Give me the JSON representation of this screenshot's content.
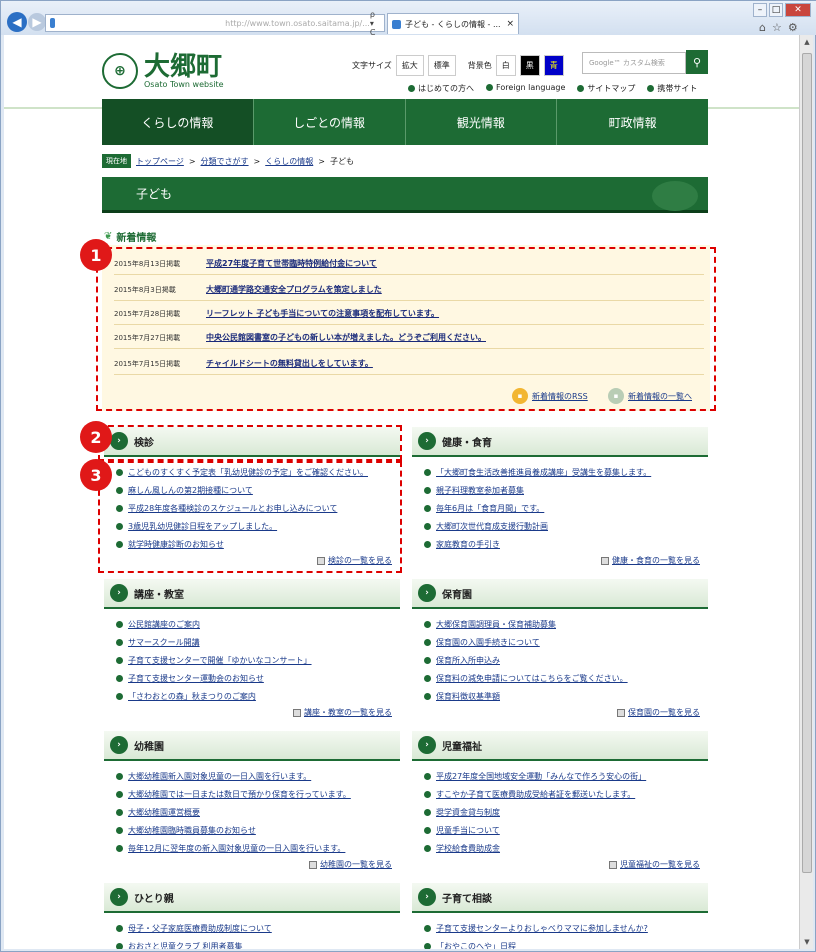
{
  "browser": {
    "address_url": "http://www.town.osato.saitama.jp/...",
    "search_hint": "ρ ▾ C",
    "tab_title": "子ども - くらしの情報 - ...",
    "tab_close": "×"
  },
  "site": {
    "name": "大郷町",
    "subtitle": "Osato Town website",
    "emblem": "⊕"
  },
  "util": {
    "fontsize_label": "文字サイズ",
    "enlarge": "拡大",
    "standard": "標準",
    "bgcolor_label": "背景色",
    "white": "白",
    "black": "黒",
    "blue": "青",
    "search_placeholder": "Google™ カスタム検索"
  },
  "header_links": [
    "はじめての方へ",
    "Foreign language",
    "サイトマップ",
    "携帯サイト"
  ],
  "global_nav": [
    "くらしの情報",
    "しごとの情報",
    "観光情報",
    "町政情報"
  ],
  "breadcrumb": {
    "here": "現在地",
    "items": [
      "トップページ",
      "分類でさがす",
      "くらしの情報"
    ],
    "current": "子ども",
    "sep": ">"
  },
  "page_title": "子ども",
  "news": {
    "heading": "新着情報",
    "items": [
      {
        "date": "2015年8月13日掲載",
        "title": "平成27年度子育て世帯臨時特例給付金について"
      },
      {
        "date": "2015年8月3日掲載",
        "title": "大郷町通学路交通安全プログラムを策定しました"
      },
      {
        "date": "2015年7月28日掲載",
        "title": "リーフレット 子ども手当についての注意事項を配布しています。"
      },
      {
        "date": "2015年7月27日掲載",
        "title": "中央公民館図書室の子どもの新しい本が増えました。どうぞご利用ください。"
      },
      {
        "date": "2015年7月15日掲載",
        "title": "チャイルドシートの無料貸出しをしています。"
      }
    ],
    "rss": "新着情報のRSS",
    "list": "新着情報の一覧へ"
  },
  "sections": [
    {
      "title": "検診",
      "items": [
        "こどものすくすく予定表「乳幼児健診の予定」をご確認ください。",
        "麻しん風しんの第2期接種について",
        "平成28年度各種検診のスケジュールとお申し込みについて",
        "3歳児乳幼児健診日程をアップしました。",
        "就学時健康診断のお知らせ"
      ],
      "more": "検診の一覧を見る"
    },
    {
      "title": "健康・食育",
      "items": [
        "「大郷町食生活改善推進員養成講座」受講生を募集します。",
        "親子料理教室参加者募集",
        "毎年6月は「食育月間」です。",
        "大郷町次世代育成支援行動計画",
        "家庭教育の手引き"
      ],
      "more": "健康・食育の一覧を見る"
    },
    {
      "title": "講座・教室",
      "items": [
        "公民館講座のご案内",
        "サマースクール開講",
        "子育て支援センターで開催「ゆかいなコンサート」",
        "子育て支援センター運動会のお知らせ",
        "「さわおとの森」秋まつりのご案内"
      ],
      "more": "講座・教室の一覧を見る"
    },
    {
      "title": "保育園",
      "items": [
        "大郷保育園調理員・保育補助募集",
        "保育園の入園手続きについて",
        "保育所入所申込み",
        "保育料の減免申請についてはこちらをご覧ください。",
        "保育料徴収基準額"
      ],
      "more": "保育園の一覧を見る"
    },
    {
      "title": "幼稚園",
      "items": [
        "大郷幼稚園新入園対象児童の一日入園を行います。",
        "大郷幼稚園では一日または数日で預かり保育を行っています。",
        "大郷幼稚園運営概要",
        "大郷幼稚園臨時職員募集のお知らせ",
        "毎年12月に翌年度の新入園対象児童の一日入園を行います。"
      ],
      "more": "幼稚園の一覧を見る"
    },
    {
      "title": "児童福祉",
      "items": [
        "平成27年度全国地域安全運動「みんなで作ろう安心の街」",
        "すこやか子育て医療費助成受給者証を郵送いたします。",
        "奨学資金貸与制度",
        "児童手当について",
        "学校給食費助成金"
      ],
      "more": "児童福祉の一覧を見る"
    },
    {
      "title": "ひとり親",
      "items": [
        "母子・父子家庭医療費助成制度について",
        "おおさと児童クラブ 利用者募集"
      ],
      "more": ""
    },
    {
      "title": "子育て相談",
      "items": [
        "子育て支援センターよりおしゃべりママに参加しませんか?",
        "「おやこのへや」日程"
      ],
      "more": ""
    }
  ],
  "annotations": [
    "1",
    "2",
    "3"
  ],
  "colors": {
    "brand_green": "#1d6b34",
    "news_bg": "#fff8e2",
    "annotation_red": "#e01818"
  },
  "icons": [
    "back-icon",
    "forward-icon",
    "ie-icon",
    "home-icon",
    "star-icon",
    "gear-icon",
    "search-icon",
    "chevron-right-icon",
    "rss-icon"
  ]
}
